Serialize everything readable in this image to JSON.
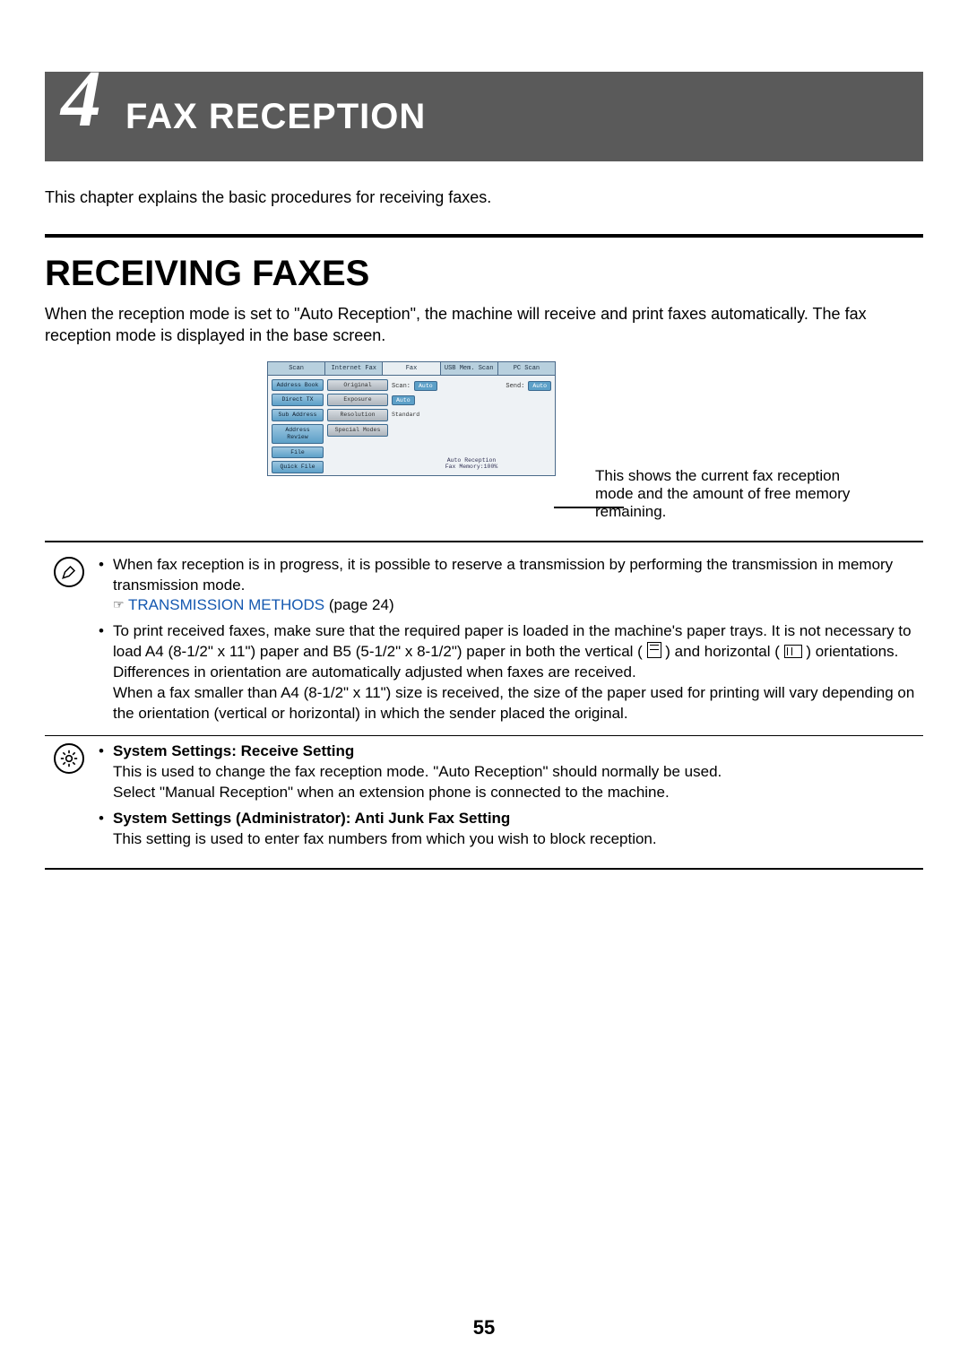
{
  "header": {
    "chapter_number": "4",
    "title": "FAX RECEPTION"
  },
  "intro": "This chapter explains the basic procedures for receiving faxes.",
  "section_heading": "RECEIVING FAXES",
  "section_para": "When the reception mode is set to \"Auto Reception\", the machine will receive and print faxes automatically. The fax reception mode is displayed in the base screen.",
  "screen": {
    "tabs": [
      "Scan",
      "Internet Fax",
      "Fax",
      "USB Mem. Scan",
      "PC Scan"
    ],
    "active_tab_index": 2,
    "left_buttons": [
      "Address Book",
      "Direct TX",
      "Sub Address",
      "Address Review",
      "File",
      "Quick File"
    ],
    "mid_buttons": [
      "Original",
      "Exposure",
      "Resolution",
      "Special Modes"
    ],
    "rows": [
      {
        "label": "Scan:",
        "box": "Auto",
        "label2": "Send:",
        "box2": "Auto"
      },
      {
        "label": "",
        "box": "Auto"
      },
      {
        "label": "Standard"
      }
    ],
    "status1": "Auto Reception",
    "status2": "Fax Memory:100%"
  },
  "callout": "This shows the current fax reception mode and the amount of free memory remaining.",
  "notes": {
    "info": [
      {
        "text": "When fax reception is in progress, it is possible to reserve a transmission by performing the transmission in memory transmission mode.",
        "link_label": "TRANSMISSION METHODS",
        "link_suffix": " (page 24)"
      },
      {
        "pre": "To print received faxes, make sure that the required paper is loaded in the machine's paper trays. It is not necessary to load A4 (8-1/2\" x 11\") paper and B5 (5-1/2\" x 8-1/2\") paper in both the vertical (",
        "mid": ") and horizontal (",
        "post": ") orientations. Differences in orientation are automatically adjusted when faxes are received.",
        "extra": "When a fax smaller than A4 (8-1/2\" x 11\") size is received, the size of the paper used for printing will vary depending on the orientation (vertical or horizontal) in which the sender placed the original."
      }
    ],
    "settings": [
      {
        "title": "System Settings: Receive Setting",
        "line1": "This is used to change the fax reception mode. \"Auto Reception\" should normally be used.",
        "line2": "Select \"Manual Reception\" when an extension phone is connected to the machine."
      },
      {
        "title": "System Settings (Administrator): Anti Junk Fax Setting",
        "line1": "This setting is used to enter fax numbers from which you wish to block reception."
      }
    ]
  },
  "page_number": "55"
}
